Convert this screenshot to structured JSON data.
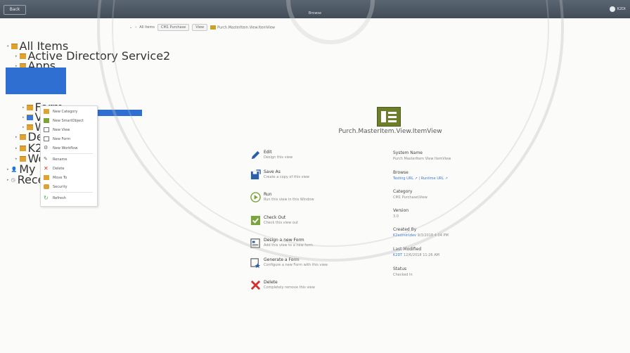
{
  "topbar": {
    "back_label": "Back",
    "app_title": "Browse",
    "user": "K2Dt"
  },
  "breadcrumb": {
    "items": [
      "All Items",
      "CM1 Purchase",
      "View",
      "Purch.MasterItem.View.ItemView"
    ]
  },
  "tree": {
    "all_items": "All Items",
    "active_directory": "Active Directory Service2",
    "apps": "Apps",
    "form": "Form",
    "view": "Vie",
    "wo": "Wo",
    "default": "Defaul",
    "k2": "K2Mi",
    "world": "World",
    "my_items": "My Items",
    "recent": "Recent It"
  },
  "context_menu": {
    "items": [
      "New Category",
      "New SmartObject",
      "New View",
      "New Form",
      "New Workflow",
      "Rename",
      "Delete",
      "Move To",
      "Security",
      "Refresh"
    ]
  },
  "view": {
    "name": "Purch.MasterItem.View.ItemView"
  },
  "actions": [
    {
      "title": "Edit",
      "desc": "Design this view",
      "icon": "edit-icon"
    },
    {
      "title": "Save As",
      "desc": "Create a copy of this view",
      "icon": "save-as-icon"
    },
    {
      "title": "Run",
      "desc": "Run this view in this Window",
      "icon": "run-icon"
    },
    {
      "title": "Check Out",
      "desc": "Check this view out",
      "icon": "check-out-icon"
    },
    {
      "title": "Design a new Form",
      "desc": "Add this view to a new form",
      "icon": "design-form-icon"
    },
    {
      "title": "Generate a Form",
      "desc": "Configure a new Form with this view",
      "icon": "generate-form-icon"
    },
    {
      "title": "Delete",
      "desc": "Completely remove this view",
      "icon": "delete-icon"
    }
  ],
  "properties": {
    "system_name_label": "System Name",
    "system_name": "Purch MasterItem View ItemView",
    "browse_label": "Browse",
    "browse_testing": "Testing URL ↗",
    "browse_runtime": "Runtime URL ↗",
    "category_label": "Category",
    "category": "CM1 Purchase\\View",
    "version_label": "Version",
    "version": "3.0",
    "created_by_label": "Created By",
    "created_by_user": "K2admin\\dev",
    "created_by_date": "9/3/2018 4:04 PM",
    "last_modified_label": "Last Modified",
    "last_modified_user": "K2DT",
    "last_modified_date": "12/6/2018 11:26 AM",
    "status_label": "Status",
    "status": "Checked In"
  },
  "colors": {
    "topbar": "#4d5764",
    "selection": "#2e6fd1",
    "view_icon": "#6e7f2c",
    "link": "#3a7bd5"
  }
}
